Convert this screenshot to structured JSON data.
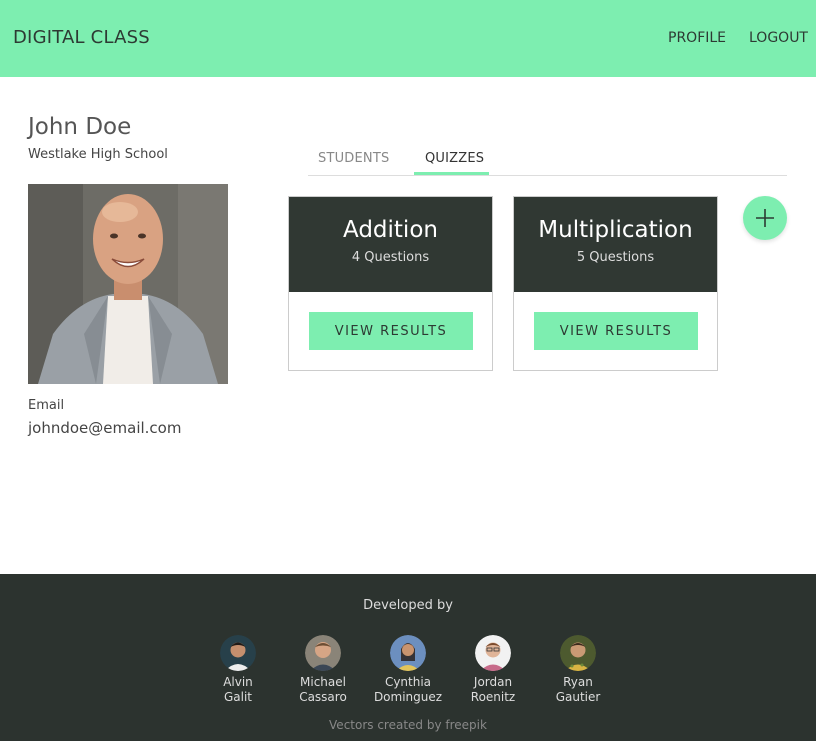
{
  "app": {
    "brand": "DIGITAL CLASS",
    "nav": {
      "profile": "PROFILE",
      "logout": "LOGOUT"
    }
  },
  "colors": {
    "accent": "#7deeb0",
    "dark": "#303833",
    "footer": "#2c332f"
  },
  "profile": {
    "name": "John Doe",
    "school": "Westlake High School",
    "photo_icon": "teacher-photo",
    "email_label": "Email",
    "email": "johndoe@email.com"
  },
  "tabs": [
    {
      "label": "STUDENTS",
      "active": false
    },
    {
      "label": "QUIZZES",
      "active": true
    }
  ],
  "quizzes": [
    {
      "title": "Addition",
      "subtitle": "4 Questions",
      "button": "VIEW RESULTS"
    },
    {
      "title": "Multiplication",
      "subtitle": "5 Questions",
      "button": "VIEW RESULTS"
    }
  ],
  "add_button_icon": "plus-icon",
  "footer": {
    "title": "Developed by",
    "developers": [
      {
        "first": "Alvin",
        "last": "Galit"
      },
      {
        "first": "Michael",
        "last": "Cassaro"
      },
      {
        "first": "Cynthia",
        "last": "Dominguez"
      },
      {
        "first": "Jordan",
        "last": "Roenitz"
      },
      {
        "first": "Ryan",
        "last": "Gautier"
      }
    ],
    "credit": "Vectors created by freepik"
  }
}
